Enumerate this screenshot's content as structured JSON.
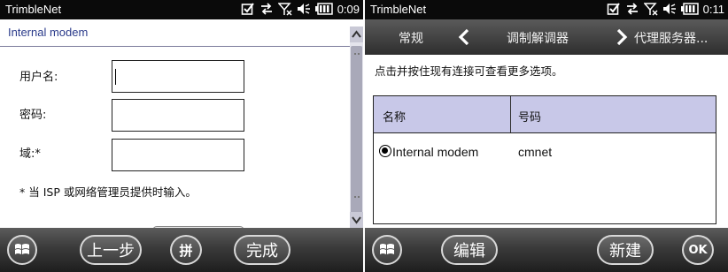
{
  "left": {
    "status": {
      "app": "TrimbleNet",
      "time": "0:09"
    },
    "title": "Internal modem",
    "fields": [
      {
        "label": "用户名:",
        "value": ""
      },
      {
        "label": "密码:",
        "value": ""
      },
      {
        "label": "域:*",
        "value": ""
      }
    ],
    "hint": "* 当 ISP 或网络管理员提供时输入。",
    "softkeys": {
      "back": "上一步",
      "input": "拼",
      "done": "完成"
    }
  },
  "right": {
    "status": {
      "app": "TrimbleNet",
      "time": "0:11"
    },
    "tabs": {
      "prev": "常规",
      "current": "调制解调器",
      "next": "代理服务器..."
    },
    "instruction": "点击并按住现有连接可查看更多选项。",
    "table": {
      "headers": [
        "名称",
        "号码"
      ],
      "rows": [
        {
          "name": "Internal modem",
          "number": "cmnet",
          "selected": true
        }
      ]
    },
    "softkeys": {
      "edit": "编辑",
      "new": "新建",
      "ok": "OK"
    }
  },
  "colors": {
    "header_bg": "#c8c8e8",
    "title_text": "#2a3a8a",
    "bar_dark": "#1e1e1e"
  },
  "icons": [
    "checkbox-icon",
    "sync-arrows-icon",
    "no-signal-icon",
    "volume-icon",
    "battery-icon",
    "windows-start-icon",
    "chevron-left-icon",
    "chevron-right-icon"
  ]
}
